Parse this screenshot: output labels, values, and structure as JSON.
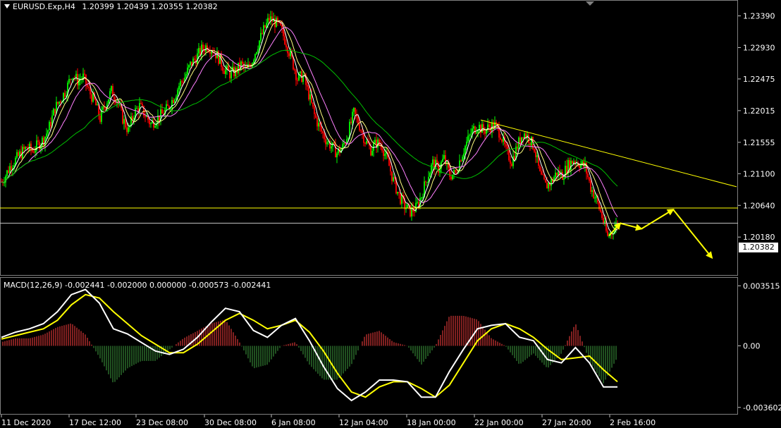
{
  "header": {
    "symbol": "EURUSD.Exp,H4",
    "ohlc": "1.20399 1.20439 1.20355 1.20382"
  },
  "macd_header": {
    "text": "MACD(12,26,9) -0.002441 -0.002000 0.000000 -0.000573 -0.002441"
  },
  "current_price": "1.20382",
  "colors": {
    "background": "#000000",
    "bull_candle": "#00ff00",
    "bear_candle": "#ff0000",
    "ma_fast": "#ffffff",
    "ma_mid": "#ffff80",
    "ma_slow": "#ff80ff",
    "ma_long": "#00c000",
    "trendline": "#ffff00",
    "macd_line": "#ffffff",
    "signal_line": "#ffff00",
    "hist_pos": "#ff4040",
    "hist_neg": "#40a040"
  },
  "chart_data": [
    {
      "type": "candlestick",
      "symbol": "EURUSD.Exp",
      "timeframe": "H4",
      "ylim": [
        1.1965,
        1.236
      ],
      "y_ticks": [
        "1.23390",
        "1.22930",
        "1.22475",
        "1.22015",
        "1.21555",
        "1.21100",
        "1.20640",
        "1.20180"
      ],
      "x_ticks": [
        "11 Dec 2020",
        "17 Dec 12:00",
        "23 Dec 08:00",
        "30 Dec 08:00",
        "6 Jan 08:00",
        "12 Jan 04:00",
        "18 Jan 00:00",
        "22 Jan 00:00",
        "27 Jan 20:00",
        "2 Feb 16:00"
      ],
      "price_path": [
        [
          0,
          1.2095
        ],
        [
          8,
          1.2108
        ],
        [
          15,
          1.2122
        ],
        [
          22,
          1.213
        ],
        [
          30,
          1.214
        ],
        [
          38,
          1.2148
        ],
        [
          46,
          1.2143
        ],
        [
          54,
          1.2152
        ],
        [
          62,
          1.216
        ],
        [
          70,
          1.2178
        ],
        [
          78,
          1.2205
        ],
        [
          86,
          1.2218
        ],
        [
          94,
          1.2232
        ],
        [
          102,
          1.2255
        ],
        [
          110,
          1.2245
        ],
        [
          118,
          1.225
        ],
        [
          126,
          1.223
        ],
        [
          134,
          1.2215
        ],
        [
          142,
          1.219
        ],
        [
          150,
          1.2212
        ],
        [
          158,
          1.223
        ],
        [
          166,
          1.2218
        ],
        [
          174,
          1.219
        ],
        [
          182,
          1.2172
        ],
        [
          190,
          1.2198
        ],
        [
          198,
          1.2208
        ],
        [
          206,
          1.2195
        ],
        [
          214,
          1.2182
        ],
        [
          222,
          1.219
        ],
        [
          230,
          1.2196
        ],
        [
          238,
          1.2205
        ],
        [
          246,
          1.222
        ],
        [
          254,
          1.2238
        ],
        [
          262,
          1.225
        ],
        [
          270,
          1.2268
        ],
        [
          278,
          1.2278
        ],
        [
          286,
          1.229
        ],
        [
          294,
          1.2296
        ],
        [
          302,
          1.229
        ],
        [
          310,
          1.2278
        ],
        [
          318,
          1.2262
        ],
        [
          326,
          1.2255
        ],
        [
          334,
          1.2258
        ],
        [
          342,
          1.2268
        ],
        [
          350,
          1.226
        ],
        [
          358,
          1.2275
        ],
        [
          366,
          1.2298
        ],
        [
          374,
          1.2318
        ],
        [
          382,
          1.2335
        ],
        [
          390,
          1.233
        ],
        [
          398,
          1.232
        ],
        [
          406,
          1.23
        ],
        [
          414,
          1.2275
        ],
        [
          422,
          1.2248
        ],
        [
          430,
          1.2252
        ],
        [
          438,
          1.2225
        ],
        [
          446,
          1.2195
        ],
        [
          454,
          1.2175
        ],
        [
          462,
          1.216
        ],
        [
          470,
          1.215
        ],
        [
          478,
          1.214
        ],
        [
          486,
          1.2148
        ],
        [
          494,
          1.217
        ],
        [
          502,
          1.2198
        ],
        [
          510,
          1.218
        ],
        [
          518,
          1.2158
        ],
        [
          526,
          1.2145
        ],
        [
          534,
          1.2155
        ],
        [
          542,
          1.215
        ],
        [
          550,
          1.2128
        ],
        [
          558,
          1.21
        ],
        [
          566,
          1.2078
        ],
        [
          574,
          1.2063
        ],
        [
          582,
          1.2055
        ],
        [
          590,
          1.206
        ],
        [
          598,
          1.2078
        ],
        [
          606,
          1.2105
        ],
        [
          614,
          1.2125
        ],
        [
          622,
          1.2118
        ],
        [
          630,
          1.2132
        ],
        [
          638,
          1.2108
        ],
        [
          646,
          1.211
        ],
        [
          654,
          1.2135
        ],
        [
          662,
          1.2155
        ],
        [
          670,
          1.2172
        ],
        [
          678,
          1.218
        ],
        [
          686,
          1.2172
        ],
        [
          694,
          1.2178
        ],
        [
          702,
          1.218
        ],
        [
          710,
          1.2168
        ],
        [
          718,
          1.2142
        ],
        [
          726,
          1.2128
        ],
        [
          734,
          1.215
        ],
        [
          742,
          1.217
        ],
        [
          750,
          1.2162
        ],
        [
          758,
          1.2148
        ],
        [
          766,
          1.2108
        ],
        [
          774,
          1.2092
        ],
        [
          782,
          1.2098
        ],
        [
          790,
          1.2112
        ],
        [
          798,
          1.2108
        ],
        [
          806,
          1.2122
        ],
        [
          814,
          1.213
        ],
        [
          822,
          1.2125
        ],
        [
          830,
          1.212
        ],
        [
          838,
          1.209
        ],
        [
          846,
          1.2072
        ],
        [
          854,
          1.2048
        ],
        [
          862,
          1.2018
        ],
        [
          870,
          1.203
        ],
        [
          876,
          1.2038
        ]
      ],
      "support_lines": [
        1.20602,
        1.20382
      ],
      "trendline": {
        "from": [
          682,
          1.2188
        ],
        "to": [
          1045,
          1.2091
        ]
      },
      "forecast_arrows": [
        {
          "from": [
            864,
            1.202
          ],
          "to": [
            880,
            1.2038
          ]
        },
        {
          "from": [
            880,
            1.2038
          ],
          "to": [
            910,
            1.203
          ]
        },
        {
          "from": [
            910,
            1.203
          ],
          "to": [
            955,
            1.2058
          ]
        },
        {
          "from": [
            955,
            1.2058
          ],
          "to": [
            1010,
            1.1988
          ]
        }
      ]
    },
    {
      "type": "line",
      "name": "MACD(12,26,9)",
      "ylim": [
        -0.0039,
        0.0039
      ],
      "y_ticks": [
        "0.003515",
        "0.00",
        "-0.003602"
      ],
      "zero": 0,
      "series": [
        {
          "name": "macd",
          "values": [
            0.0005,
            0.0008,
            0.001,
            0.0013,
            0.002,
            0.003,
            0.0033,
            0.0025,
            0.001,
            0.0007,
            0.0002,
            -0.0003,
            -0.0005,
            -0.0002,
            0.0005,
            0.0014,
            0.0022,
            0.002,
            0.0009,
            0.0005,
            0.0012,
            0.0016,
            0.0003,
            -0.0012,
            -0.0025,
            -0.0032,
            -0.0027,
            -0.002,
            -0.002,
            -0.0021,
            -0.003,
            -0.003,
            -0.0015,
            -0.0002,
            0.001,
            0.0012,
            0.0013,
            0.0005,
            0.0003,
            -0.0008,
            -0.001,
            -0.0001,
            -0.001,
            -0.0024,
            -0.0024
          ]
        },
        {
          "name": "signal",
          "values": [
            0.0004,
            0.0006,
            0.0008,
            0.001,
            0.0015,
            0.0024,
            0.003,
            0.0028,
            0.002,
            0.0013,
            0.0006,
            0.0001,
            -0.0004,
            -0.0004,
            0.0001,
            0.0008,
            0.0015,
            0.0019,
            0.0015,
            0.001,
            0.0012,
            0.0015,
            0.0008,
            -0.0003,
            -0.0016,
            -0.0027,
            -0.003,
            -0.0024,
            -0.0021,
            -0.0021,
            -0.0025,
            -0.003,
            -0.0023,
            -0.001,
            0.0003,
            0.001,
            0.0013,
            0.001,
            0.0005,
            -0.0002,
            -0.0008,
            -0.0007,
            -0.0006,
            -0.0014,
            -0.0021
          ]
        }
      ]
    }
  ]
}
